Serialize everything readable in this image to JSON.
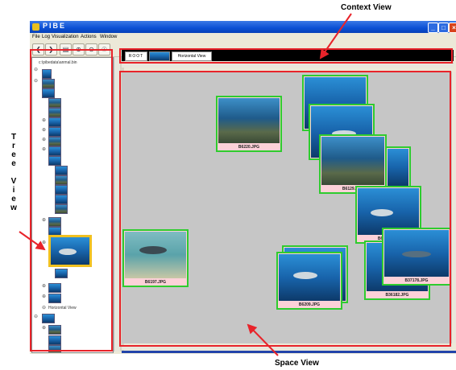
{
  "window": {
    "title": "PIBE"
  },
  "menu": [
    "File",
    "Log",
    "Visualization",
    "Actions",
    "Window"
  ],
  "toolbar": {
    "icons": [
      "back-arrow-icon",
      "forward-arrow-icon",
      "save-icon",
      "zoom-in-icon",
      "zoom-out-icon",
      "zoom-fit-icon"
    ],
    "glyphs": [
      "❮",
      "❯",
      "▤",
      "⊕",
      "⊖",
      "☉"
    ]
  },
  "tree": {
    "root_path": "c:\\pibedata\\anmal.bin",
    "node_label": "Horizontal View"
  },
  "context": {
    "root_label": "ROOT",
    "view_label": "Horizontal View"
  },
  "space": {
    "cards": [
      {
        "caption": "B6220.JPG",
        "style": "reef"
      },
      {
        "caption": "",
        "style": "ocean"
      },
      {
        "caption": "",
        "style": "ocean"
      },
      {
        "caption": "B6129.JPG",
        "style": "reef"
      },
      {
        "caption": "",
        "style": "ocean"
      },
      {
        "caption": "B6215.JPG",
        "style": "ocean"
      },
      {
        "caption": "B6197.JPG",
        "style": "sand"
      },
      {
        "caption": "",
        "style": "ocean"
      },
      {
        "caption": "B6209.JPG",
        "style": "ocean"
      },
      {
        "caption": "B36182.JPG",
        "style": "ocean"
      },
      {
        "caption": "B37178.JPG",
        "style": "ocean"
      }
    ]
  },
  "annotations": {
    "context_view": "Context View",
    "tree_view": [
      "T",
      "r",
      "e",
      "e",
      "",
      "V",
      "i",
      "e",
      "w"
    ],
    "space_view": "Space View"
  },
  "colors": {
    "annotation_red": "#e8232a",
    "card_border_green": "#2ecc2e",
    "selected_border_yellow": "#f0c020",
    "space_background": "#c6c6c6",
    "titlebar_blue": "#0a4fd4"
  }
}
